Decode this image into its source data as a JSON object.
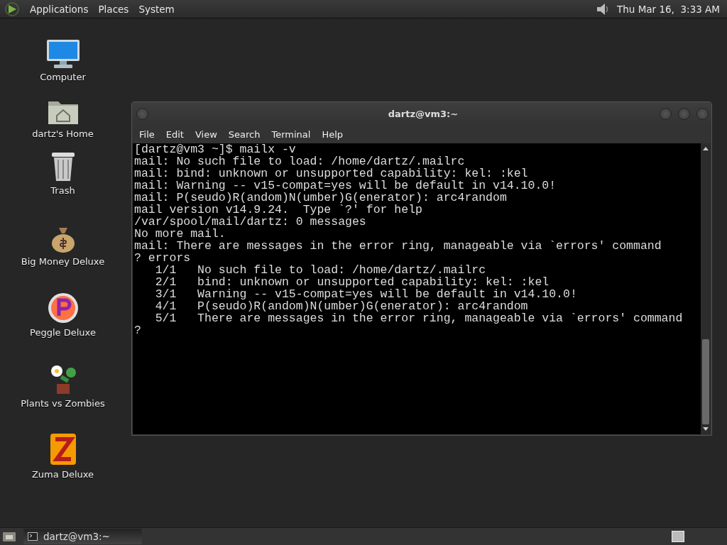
{
  "top_panel": {
    "menus": [
      "Applications",
      "Places",
      "System"
    ],
    "clock": "Thu Mar 16,  3:33 AM"
  },
  "desktop_icons": [
    {
      "label": "Computer"
    },
    {
      "label": "dartz's Home"
    },
    {
      "label": "Trash"
    },
    {
      "label": "Big Money Deluxe"
    },
    {
      "label": "Peggle Deluxe"
    },
    {
      "label": "Plants vs Zombies"
    },
    {
      "label": "Zuma Deluxe"
    }
  ],
  "window": {
    "title": "dartz@vm3:~",
    "menus": [
      "File",
      "Edit",
      "View",
      "Search",
      "Terminal",
      "Help"
    ],
    "lines": [
      "[dartz@vm3 ~]$ mailx -v",
      "mail: No such file to load: /home/dartz/.mailrc",
      "mail: bind: unknown or unsupported capability: kel: :kel",
      "mail: Warning -- v15-compat=yes will be default in v14.10.0!",
      "mail: P(seudo)R(andom)N(umber)G(enerator): arc4random",
      "mail version v14.9.24.  Type `?' for help",
      "/var/spool/mail/dartz: 0 messages",
      "No more mail.",
      "mail: There are messages in the error ring, manageable via `errors' command",
      "? errors",
      "   1/1   No such file to load: /home/dartz/.mailrc",
      "   2/1   bind: unknown or unsupported capability: kel: :kel",
      "   3/1   Warning -- v15-compat=yes will be default in v14.10.0!",
      "   4/1   P(seudo)R(andom)N(umber)G(enerator): arc4random",
      "   5/1   There are messages in the error ring, manageable via `errors' command",
      "?"
    ]
  },
  "taskbar": {
    "tasks": [
      {
        "label": "dartz@vm3:~",
        "selected": false
      }
    ]
  }
}
